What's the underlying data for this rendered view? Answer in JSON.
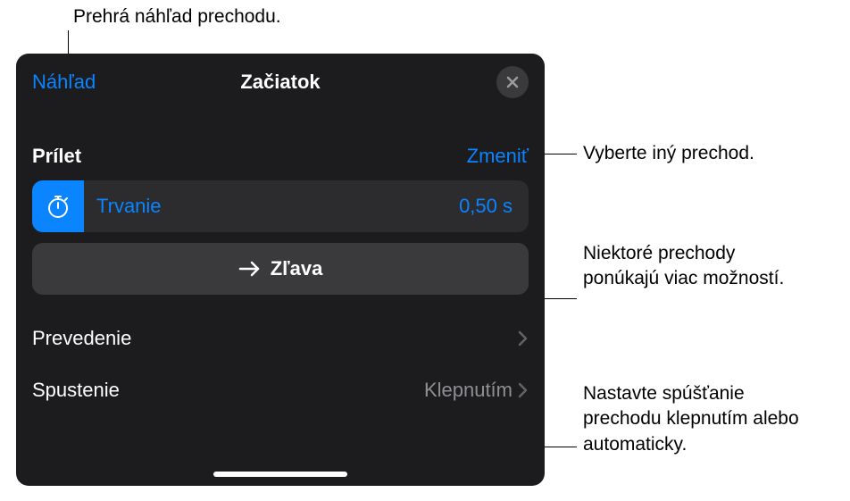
{
  "callouts": {
    "top": "Prehrá náhľad prechodu.",
    "change": "Vyberte iný prechod.",
    "direction": "Niektoré prechody ponúkajú viac možností.",
    "start": "Nastavte spúšťanie prechodu klepnutím alebo automaticky."
  },
  "header": {
    "preview": "Náhľad",
    "title": "Začiatok"
  },
  "transition": {
    "section_title": "Prílet",
    "change": "Zmeniť",
    "duration_label": "Trvanie",
    "duration_value": "0,50 s",
    "direction_label": "Zľava",
    "delivery_label": "Prevedenie",
    "start_label": "Spustenie",
    "start_value": "Klepnutím"
  }
}
